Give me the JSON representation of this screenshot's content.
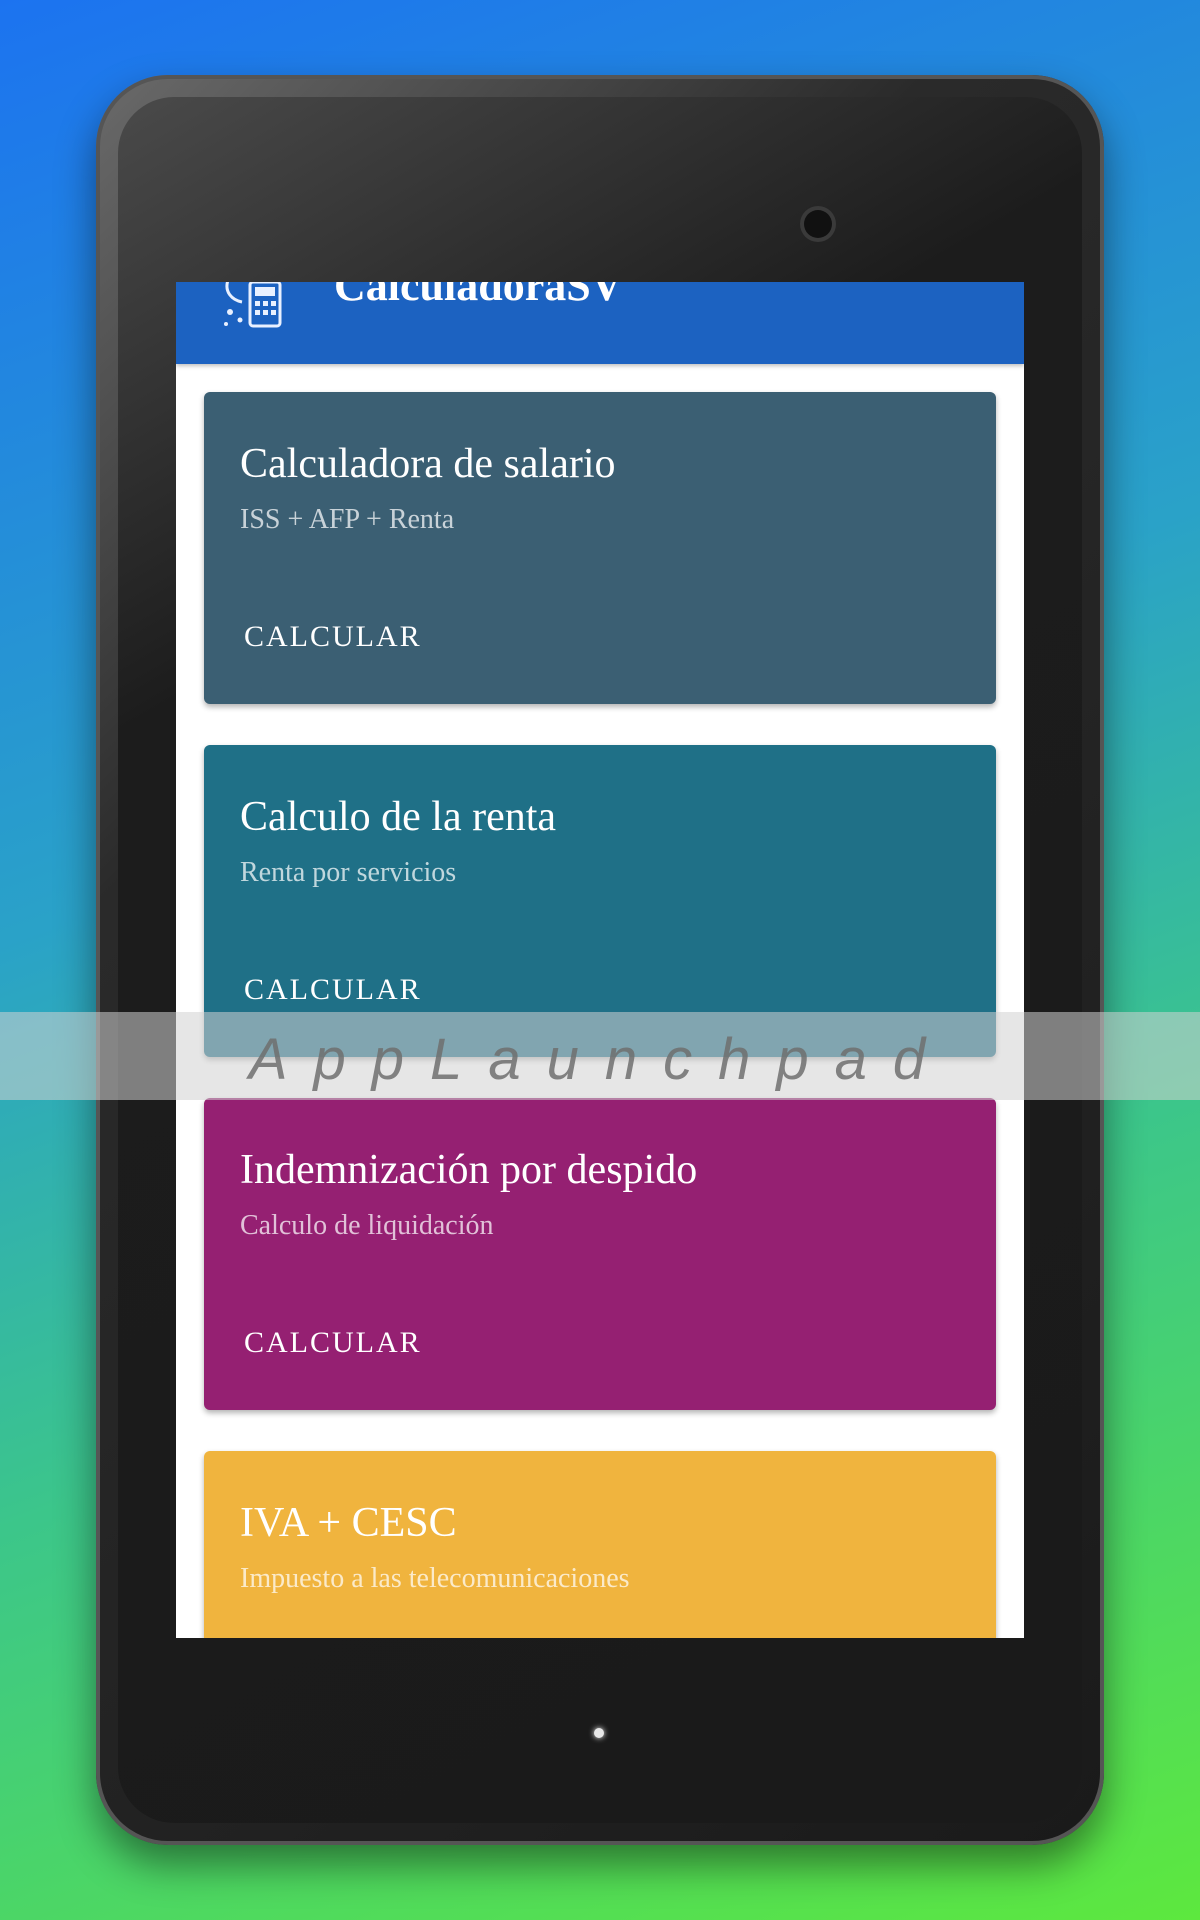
{
  "app": {
    "title": "CalculadoraSV"
  },
  "cards": [
    {
      "title": "Calculadora de salario",
      "subtitle": "ISS + AFP + Renta",
      "action": "CALCULAR",
      "color": "#3b5f73"
    },
    {
      "title": "Calculo de la renta",
      "subtitle": "Renta por servicios",
      "action": "CALCULAR",
      "color": "#1f7087"
    },
    {
      "title": "Indemnización por despido",
      "subtitle": "Calculo de liquidación",
      "action": "CALCULAR",
      "color": "#952072"
    },
    {
      "title": "IVA + CESC",
      "subtitle": "Impuesto a las telecomunicaciones",
      "color": "#f0b43e"
    }
  ],
  "watermark": {
    "text": "AppLaunchpad"
  },
  "icons": {
    "app_logo": "calculator-icon"
  }
}
